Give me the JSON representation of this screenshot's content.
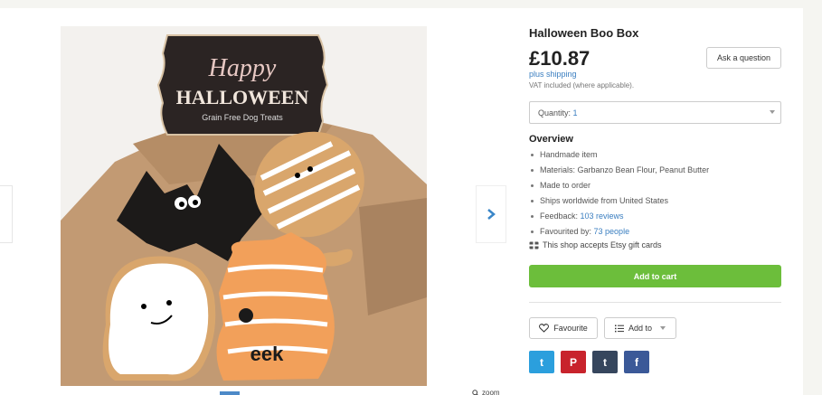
{
  "listing": {
    "title": "Halloween Boo Box",
    "price": "£10.87",
    "shipping_link": "plus shipping",
    "vat_note": "VAT included (where applicable).",
    "ask_label": "Ask a question",
    "quantity_label": "Quantity:",
    "quantity_value": "1",
    "overview_heading": "Overview",
    "overview_items": [
      {
        "text": "Handmade item"
      },
      {
        "text": "Materials: Garbanzo Bean Flour, Peanut Butter"
      },
      {
        "text": "Made to order"
      },
      {
        "text": "Ships worldwide from United States"
      },
      {
        "text": "Feedback: ",
        "link": "103 reviews"
      },
      {
        "text": "Favourited by: ",
        "link": "73 people"
      }
    ],
    "gift_card_text": "This shop accepts Etsy gift cards",
    "add_to_cart_label": "Add to cart",
    "favourite_label": "Favourite",
    "add_to_label": "Add to"
  },
  "image": {
    "sign_line1": "Happy",
    "sign_line2": "HALLOWEEN",
    "sign_line3": "Grain Free Dog Treats",
    "cookie_text": "eek",
    "zoom_label": "zoom"
  },
  "share": {
    "twitter": "t",
    "pinterest": "P",
    "tumblr": "t",
    "facebook": "f"
  },
  "colors": {
    "accent_green": "#6cbe3b",
    "link_blue": "#3a7ec0",
    "twitter": "#2b9fdd",
    "pinterest": "#c8232c",
    "tumblr": "#36465d",
    "facebook": "#3b5998"
  }
}
